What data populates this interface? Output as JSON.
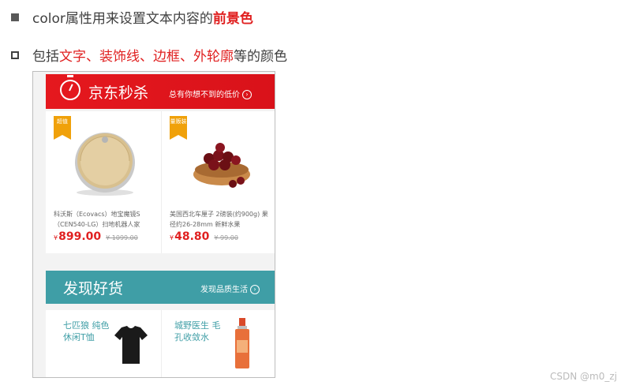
{
  "lines": [
    {
      "text_a": "color属性用来设置文本内容的",
      "highlight": "前景色"
    },
    {
      "text_a": "包括",
      "highlight": "文字、装饰线、边框、外轮廓",
      "text_b": "等的颜色"
    }
  ],
  "screenshot": {
    "seckill": {
      "title": "京东秒杀",
      "subtitle": "总有你想不到的低价",
      "arrow": "›"
    },
    "products": [
      {
        "tag": "超值",
        "name": "科沃斯（Ecovacs）地宝魔镜S（CEN540-LG）扫地机器人家",
        "currency": "¥",
        "price": "899.00",
        "old_price": "¥ 1099.00"
      },
      {
        "tag": "量贩装",
        "name": "美国西北车厘子 2磅装(约900g) 果径约26-28mm 新鲜水果",
        "currency": "¥",
        "price": "48.80",
        "old_price": "¥ 99.00"
      }
    ],
    "discover": {
      "title": "发现好货",
      "subtitle": "发现品质生活",
      "arrow": "›"
    },
    "goods": [
      {
        "name_line1": "七匹狼 纯色",
        "name_line2": "休闲T恤"
      },
      {
        "name_line1": "城野医生 毛",
        "name_line2": "孔收敛水"
      }
    ]
  },
  "watermark": "CSDN @m0_zj",
  "colors": {
    "accent_red": "#e02020",
    "banner_red": "#e5181e",
    "banner_teal": "#3f9ea6",
    "tag_orange": "#f0a10a"
  }
}
